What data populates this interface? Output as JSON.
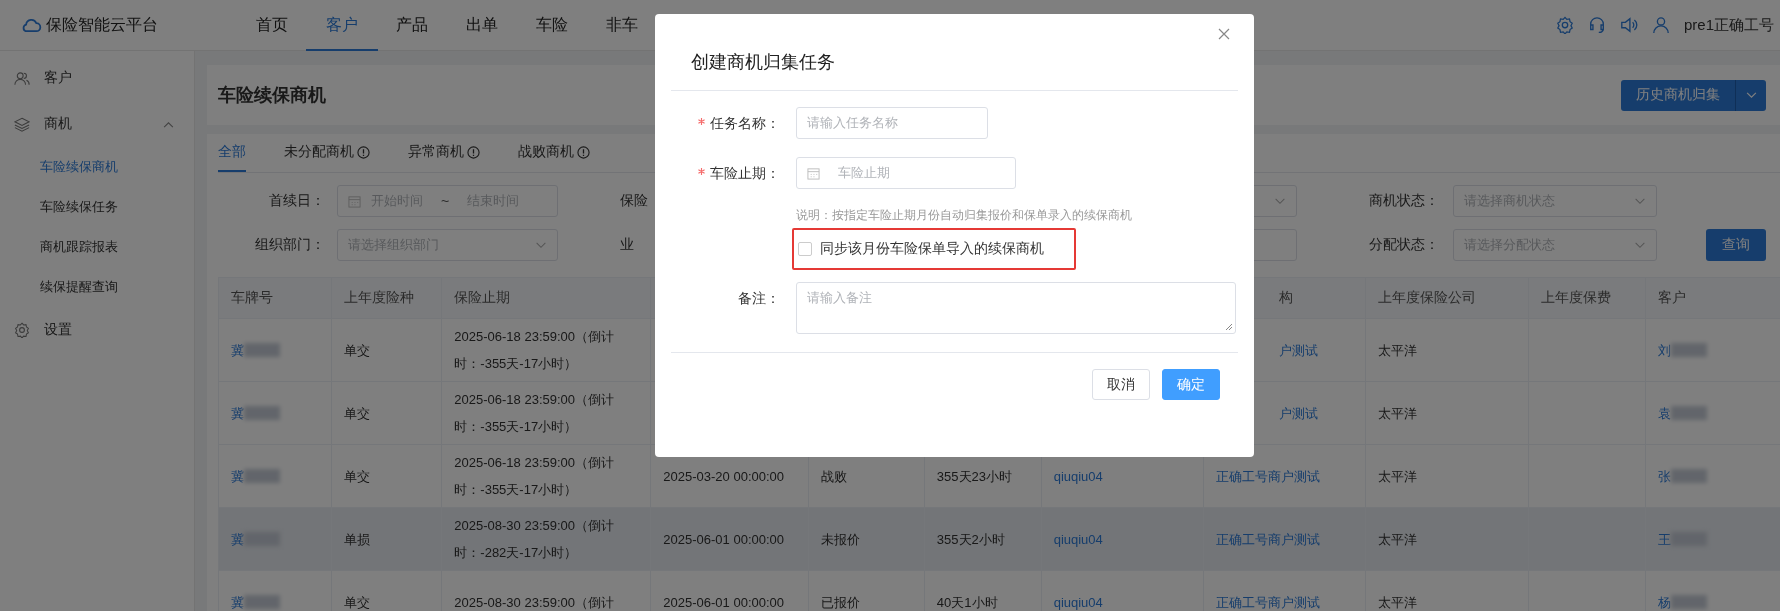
{
  "app": {
    "logo_text": "保险智能云平台"
  },
  "nav": [
    {
      "label": "首页",
      "selected": false
    },
    {
      "label": "客户",
      "selected": true
    },
    {
      "label": "产品",
      "selected": false
    },
    {
      "label": "出单",
      "selected": false
    },
    {
      "label": "车险",
      "selected": false
    },
    {
      "label": "非车",
      "selected": false
    }
  ],
  "user": {
    "name": "pre1正确工号"
  },
  "sidebar": {
    "items": [
      {
        "label": "客户"
      },
      {
        "label": "商机",
        "expanded": true,
        "children": [
          {
            "label": "车险续保商机",
            "selected": true
          },
          {
            "label": "车险续保任务",
            "selected": false
          },
          {
            "label": "商机跟踪报表",
            "selected": false
          },
          {
            "label": "续保提醒查询",
            "selected": false
          }
        ]
      },
      {
        "label": "设置"
      }
    ]
  },
  "page": {
    "title": "车险续保商机",
    "history_button": "历史商机归集"
  },
  "tabs": [
    {
      "label": "全部",
      "selected": true,
      "hint": false
    },
    {
      "label": "未分配商机",
      "selected": false,
      "hint": true
    },
    {
      "label": "异常商机",
      "selected": false,
      "hint": true
    },
    {
      "label": "战败商机",
      "selected": false,
      "hint": true
    }
  ],
  "filters": [
    [
      {
        "kind": "daterange",
        "label": "首续日：",
        "start_placeholder": "开始时间",
        "separator": "~",
        "end_placeholder": "结束时间"
      },
      {
        "kind": "select",
        "label": "保险"
      },
      {
        "kind": "select",
        "label": "商机状态：",
        "placeholder": "请选择商机状态"
      }
    ],
    [
      {
        "kind": "select",
        "label": "组织部门：",
        "placeholder": "请选择组织部门"
      },
      {
        "kind": "input",
        "label": "业"
      },
      {
        "kind": "select",
        "label": "分配状态：",
        "placeholder": "请选择分配状态"
      }
    ]
  ],
  "query_button": "查询",
  "table": {
    "columns": [
      "车牌号",
      "上年度险种",
      "保险止期",
      null,
      null,
      null,
      null,
      "构",
      "上年度保险公司",
      "上年度保费",
      "客户"
    ],
    "rows": [
      {
        "highlighted": false,
        "cells": [
          "冀",
          "单交",
          "2025-06-18 23:59:00（倒计时：-355天-17小时）",
          null,
          null,
          null,
          null,
          "户测试",
          "太平洋",
          null,
          "刘"
        ]
      },
      {
        "highlighted": false,
        "cells": [
          "冀",
          "单交",
          "2025-06-18 23:59:00（倒计时：-355天-17小时）",
          null,
          null,
          null,
          null,
          "户测试",
          "太平洋",
          null,
          "袁"
        ]
      },
      {
        "highlighted": false,
        "cells": [
          "冀",
          "单交",
          "2025-06-18 23:59:00（倒计时：-355天-17小时）",
          "2025-03-20 00:00:00",
          "战败",
          "355天23小时",
          "qiuqiu04",
          "正确工号商户测试",
          "太平洋",
          null,
          "张"
        ]
      },
      {
        "highlighted": true,
        "cells": [
          "冀",
          "单损",
          "2025-08-30 23:59:00（倒计时：-282天-17小时）",
          "2025-06-01 00:00:00",
          "未报价",
          "355天2小时",
          "qiuqiu04",
          "正确工号商户测试",
          "太平洋",
          null,
          "王"
        ]
      },
      {
        "highlighted": false,
        "cells": [
          "冀",
          "单交",
          "2025-08-30 23:59:00（倒计",
          "2025-06-01 00:00:00",
          "已报价",
          "40天1小时",
          "qiuqiu04",
          "正确工号商户测试",
          "太平洋",
          null,
          "杨"
        ]
      }
    ]
  },
  "dialog": {
    "title": "创建商机归集任务",
    "fields": [
      {
        "kind": "input",
        "label": "任务名称：",
        "required": true,
        "placeholder": "请输入任务名称"
      },
      {
        "kind": "date",
        "label": "车险止期：",
        "required": true,
        "placeholder": "车险止期"
      },
      {
        "kind": "note",
        "text": "说明：按指定车险止期月份自动归集报价和保单录入的续保商机"
      },
      {
        "kind": "checkbox",
        "label": "同步该月份车险保单导入的续保商机",
        "checked": false,
        "highlighted": true
      },
      {
        "kind": "textarea",
        "label": "备注：",
        "required": false,
        "placeholder": "请输入备注"
      }
    ],
    "buttons": [
      {
        "label": "取消",
        "primary": false
      },
      {
        "label": "确定",
        "primary": true
      }
    ]
  }
}
